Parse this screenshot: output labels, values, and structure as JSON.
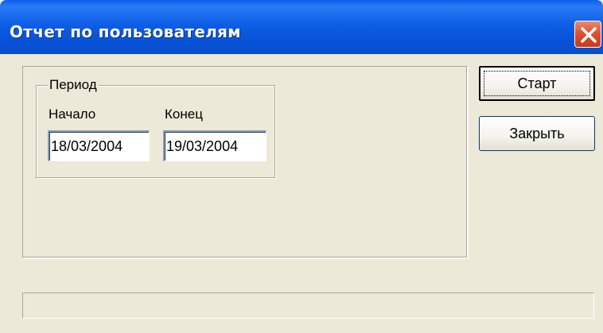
{
  "window": {
    "title": "Отчет по пользователям",
    "close_icon": "close-x"
  },
  "period_group": {
    "legend": "Период",
    "start": {
      "label": "Начало",
      "value": "18/03/2004"
    },
    "end": {
      "label": "Конец",
      "value": "19/03/2004"
    }
  },
  "buttons": {
    "start_label": "Старт",
    "close_label": "Закрыть"
  },
  "colors": {
    "titlebar": "#0A5FE8",
    "dialog_bg": "#ECE9D8",
    "close_button": "#E0522F"
  }
}
